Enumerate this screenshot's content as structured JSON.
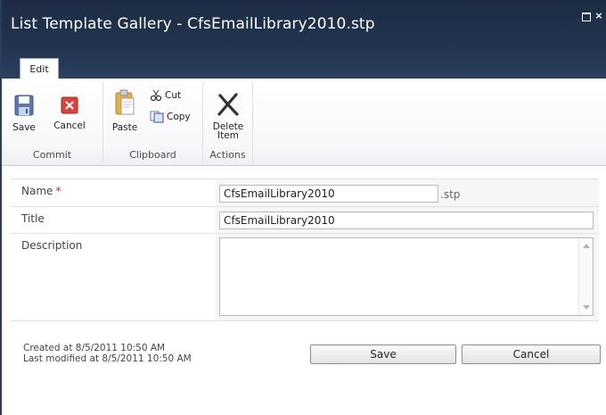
{
  "window": {
    "title": "List Template Gallery - CfsEmailLibrary2010.stp",
    "maximize_label": "",
    "close_label": "×"
  },
  "ribbon": {
    "tab_edit": "Edit",
    "groups": {
      "commit": {
        "label": "Commit",
        "save": "Save",
        "cancel": "Cancel"
      },
      "clipboard": {
        "label": "Clipboard",
        "paste": "Paste",
        "cut": "Cut",
        "copy": "Copy"
      },
      "actions": {
        "label": "Actions",
        "delete_line1": "Delete",
        "delete_line2": "Item"
      }
    }
  },
  "form": {
    "name": {
      "label": "Name",
      "required": "*",
      "value": "CfsEmailLibrary2010",
      "suffix": ".stp"
    },
    "title": {
      "label": "Title",
      "value": "CfsEmailLibrary2010"
    },
    "description": {
      "label": "Description",
      "value": ""
    }
  },
  "footer": {
    "created": "Created at 8/5/2011 10:50 AM",
    "modified": "Last modified at 8/5/2011 10:50 AM",
    "save": "Save",
    "cancel": "Cancel"
  },
  "colors": {
    "titlebar": "#22344f",
    "required": "#d21f1f"
  }
}
